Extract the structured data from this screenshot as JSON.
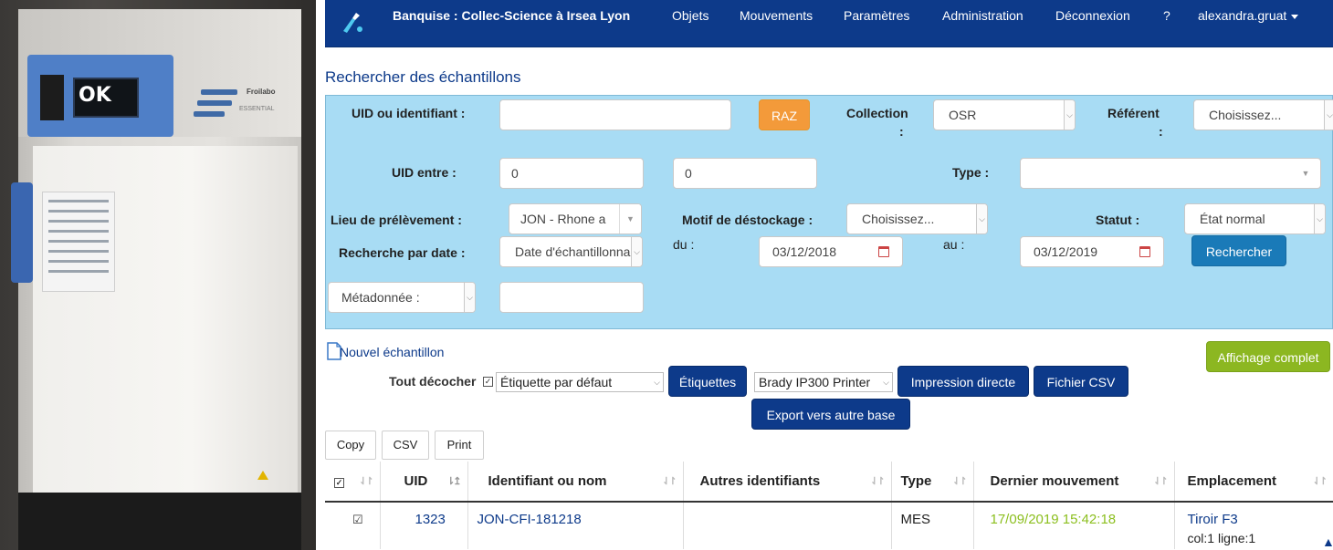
{
  "photo": {
    "display_text": "OK",
    "brand": "Froilabo",
    "model": "ESSENTIAL"
  },
  "navbar": {
    "brand": "Banquise : Collec-Science à Irsea Lyon",
    "items": [
      "Objets",
      "Mouvements",
      "Paramètres",
      "Administration",
      "Déconnexion",
      "?"
    ],
    "user": "alexandra.gruat",
    "bg_color": "#0d3a8a"
  },
  "page_title": "Rechercher des échantillons",
  "search": {
    "uid_label": "UID ou identifiant :",
    "uid_value": "",
    "raz_label": "RAZ",
    "collection_label": "Collection",
    "collection_colon": ":",
    "collection_value": "OSR",
    "referent_label": "Référent",
    "referent_colon": ":",
    "referent_value": "Choisissez...",
    "uid_between_label": "UID entre :",
    "uid_from": "0",
    "uid_to": "0",
    "type_label": "Type :",
    "type_value": "",
    "lieu_label": "Lieu de prélèvement :",
    "lieu_value": "JON - Rhone a",
    "motif_label": "Motif de déstockage :",
    "motif_value": "Choisissez...",
    "statut_label": "Statut :",
    "statut_value": "État normal",
    "date_label": "Recherche par date :",
    "date_type_value": "Date d'échantillonnage",
    "du_label": "du :",
    "date_from": "03/12/2018",
    "au_label": "au :",
    "date_to": "03/12/2019",
    "search_button": "Rechercher",
    "metadata_value": "Métadonnée :",
    "metadata_input": "",
    "panel_color": "#a8dcf4"
  },
  "actions": {
    "new_sample": "Nouvel échantillon",
    "full_display": "Affichage complet",
    "uncheck_all": "Tout décocher",
    "label_value": "Étiquette par défaut",
    "labels_button": "Étiquettes",
    "printer_value": "Brady IP300 Printer",
    "direct_print": "Impression directe",
    "csv_file": "Fichier CSV",
    "export_other": "Export vers autre base"
  },
  "table_tools": [
    "Copy",
    "CSV",
    "Print"
  ],
  "table": {
    "columns": [
      "",
      "UID",
      "Identifiant ou nom",
      "Autres identifiants",
      "Type",
      "Dernier mouvement",
      "Emplacement"
    ],
    "rows": [
      {
        "checked": "☑",
        "uid": "1323",
        "identifiant": "JON-CFI-181218",
        "autres": "",
        "type": "MES",
        "dernier_mouvement": "17/09/2019 15:42:18",
        "emplacement": "Tiroir F3",
        "emplacement_detail": "col:1 ligne:1"
      }
    ]
  }
}
